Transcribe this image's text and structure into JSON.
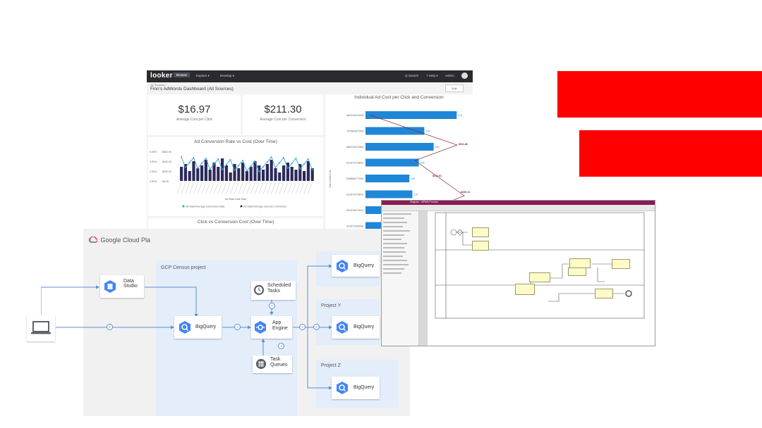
{
  "red_bars_color": "#ff0000",
  "looker": {
    "logo": "looker",
    "nav": [
      "Browse",
      "Explore ▾",
      "Develop ▾"
    ],
    "nav_right": [
      "Q Search",
      "? Help ▾",
      "Admin"
    ],
    "breadcrumb": "All Sources ›",
    "title": "Finn's AdWords Dashboard (All Sources)",
    "edit_label": "Edit",
    "kpi1": {
      "value": "$16.97",
      "label": "Average Cost per Click"
    },
    "kpi2": {
      "value": "$211.30",
      "label": "Average Cost per Conversion"
    },
    "chart1_title": "Ad Conversion Rate vs Cost (Over Time)",
    "chart1_xlabel": "Ad Stats Date Date",
    "chart1_legend": [
      "Ad Stats Average Conversion Rate",
      "Ad Stats Average Cost per Conversion"
    ],
    "chart2_title": "Click vs Conversion Cost (Over Time)",
    "chart3_title": "Individual Ad Cost per Click and Conversion",
    "chart3_ylabel": "Ads Creative ID"
  },
  "chart_data": [
    {
      "type": "bar",
      "title": "Individual Ad Cost per Click and Conversion",
      "ylabel": "Ads Creative ID",
      "categories": [
        "884249411536",
        "707584607536",
        "886249411568",
        "811674178649",
        "848888277536",
        "811674178576",
        "822076074934",
        "811674180506",
        "188888488616"
      ],
      "values": [
        214,
        138,
        160,
        125,
        103,
        110,
        115,
        112,
        108
      ],
      "line_labels": [
        "$541.86",
        "$212.81",
        "$285.13"
      ]
    },
    {
      "type": "bar",
      "title": "Ad Conversion Rate vs Cost (Over Time)",
      "y_ticks": [
        "$600.00",
        "$400.00",
        "$200.00",
        "$0.00"
      ],
      "y2_ticks": [
        "6.00%",
        "4.00%",
        "2.00%",
        "0.00%"
      ]
    }
  ],
  "gcp": {
    "header": "Google Cloud Pla",
    "census_project": "GCP Census project",
    "project_y": "Project Y",
    "project_z": "Project Z",
    "data_studio": "Data Studio",
    "bigquery": "BigQuery",
    "scheduled_tasks": "Scheduled Tasks",
    "app_engine": "App Engine",
    "task_queues": "Task Queues",
    "steps": [
      "6",
      "5",
      "4",
      "1",
      "2",
      "3",
      "3"
    ]
  },
  "bpmn": {
    "title_bar": "Diagram - BPMN Process"
  }
}
